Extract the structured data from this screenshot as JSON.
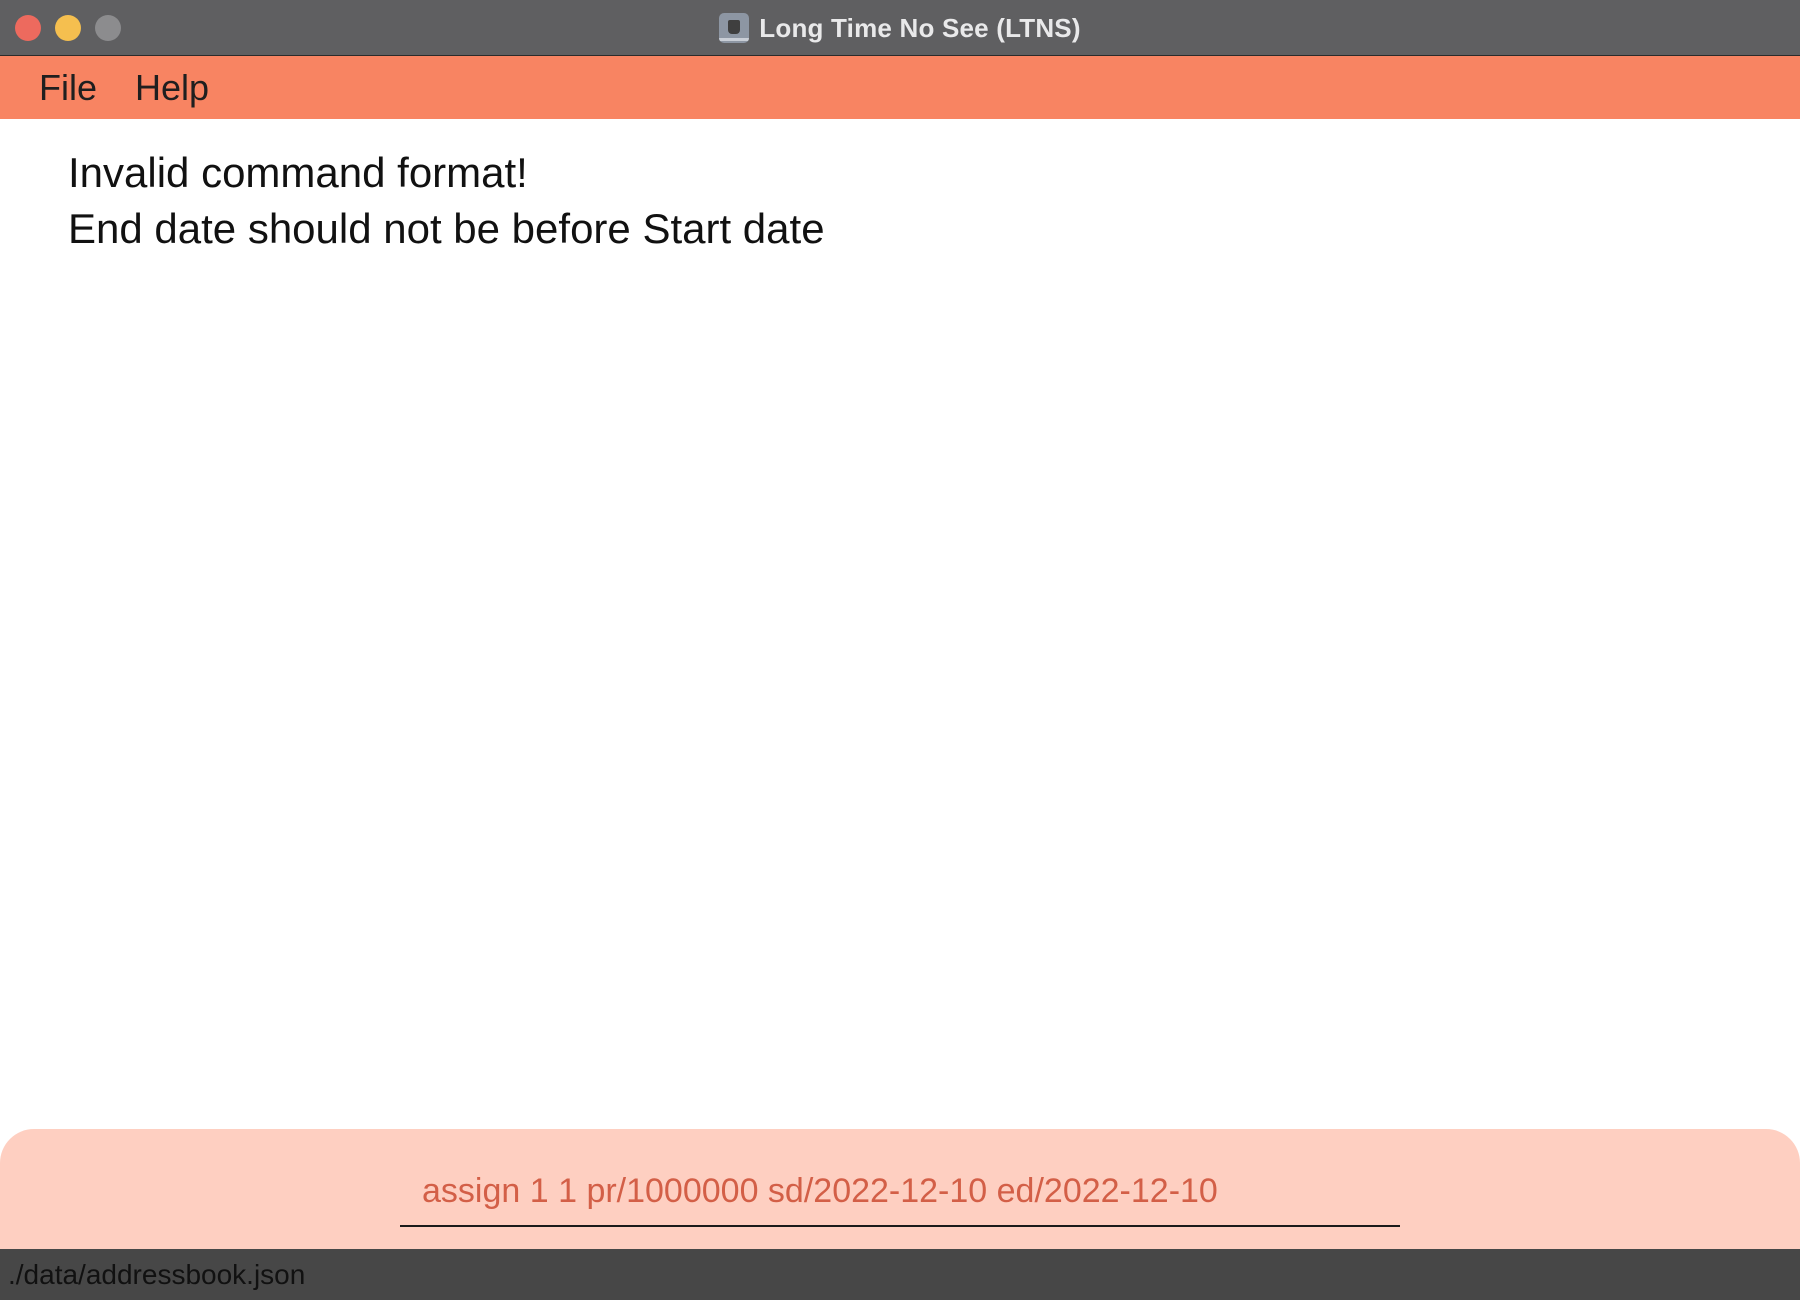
{
  "window": {
    "title": "Long Time No See (LTNS)"
  },
  "menubar": {
    "items": [
      {
        "label": "File"
      },
      {
        "label": "Help"
      }
    ]
  },
  "result": {
    "lines": [
      "Invalid command format!",
      "End date should not be before Start date"
    ]
  },
  "command": {
    "value": "assign 1 1 pr/1000000 sd/2022-12-10 ed/2022-12-10"
  },
  "status": {
    "path": "./data/addressbook.json"
  },
  "colors": {
    "titlebar": "#5f5f61",
    "menubar": "#f88462",
    "command_panel": "#fecfc1",
    "command_text": "#d35f47",
    "statusbar": "#474747"
  }
}
